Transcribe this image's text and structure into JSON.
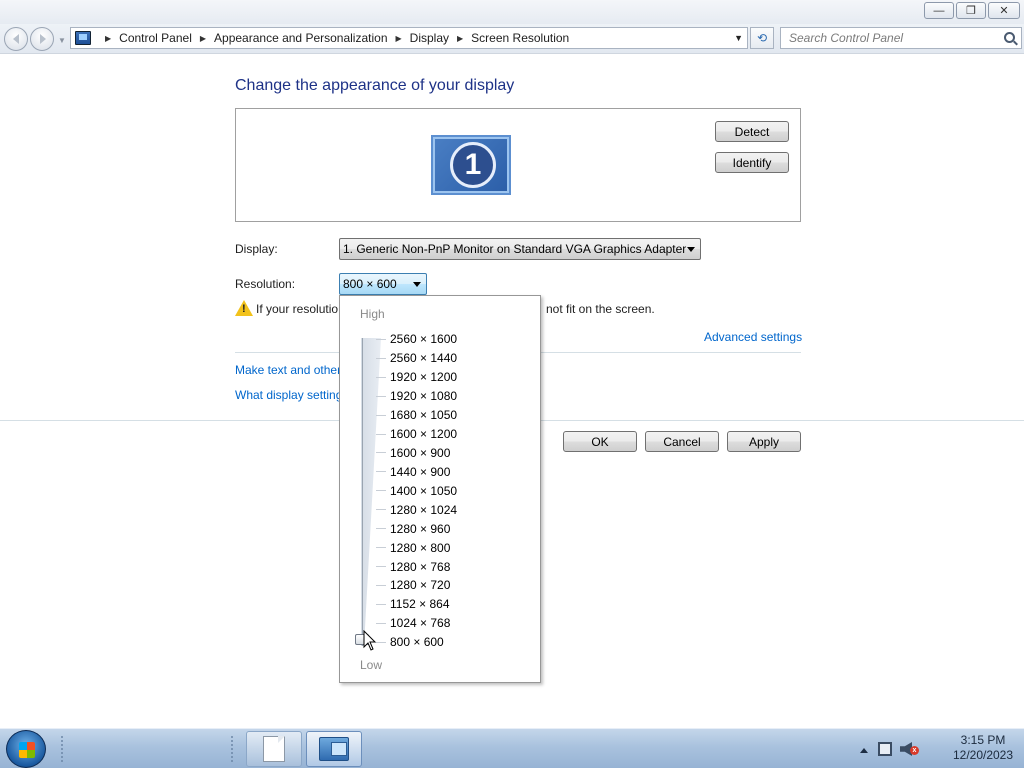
{
  "window": {
    "minimize_glyph": "—",
    "maximize_glyph": "❐",
    "close_glyph": "✕"
  },
  "navbar": {
    "breadcrumbs": [
      "Control Panel",
      "Appearance and Personalization",
      "Display",
      "Screen Resolution"
    ],
    "refresh_glyph": "⟲",
    "search_placeholder": "Search Control Panel"
  },
  "main": {
    "title": "Change the appearance of your display",
    "monitor_number": "1",
    "detect_label": "Detect",
    "identify_label": "Identify",
    "display_label": "Display:",
    "display_value": "1. Generic Non-PnP Monitor on Standard VGA Graphics Adapter",
    "resolution_label": "Resolution:",
    "resolution_value": "800 × 600",
    "warning_prefix": "If your resolutio",
    "warning_suffix": "not fit on the screen.",
    "advanced_settings": "Advanced settings",
    "link_text_size": "Make text and other",
    "link_settings": "What display setting",
    "ok_label": "OK",
    "cancel_label": "Cancel",
    "apply_label": "Apply"
  },
  "resolution_dropdown": {
    "high_label": "High",
    "low_label": "Low",
    "options": [
      "2560 × 1600",
      "2560 × 1440",
      "1920 × 1200",
      "1920 × 1080",
      "1680 × 1050",
      "1600 × 1200",
      "1600 × 900",
      "1440 × 900",
      "1400 × 1050",
      "1280 × 1024",
      "1280 × 960",
      "1280 × 800",
      "1280 × 768",
      "1280 × 720",
      "1152 × 864",
      "1024 × 768",
      "800 × 600"
    ],
    "selected": "800 × 600"
  },
  "taskbar": {
    "clock_time": "3:15 PM",
    "clock_date": "12/20/2023",
    "mute_glyph": "x",
    "icons": [
      "start-orb",
      "notepad-icon",
      "control-panel-icon",
      "network-icon",
      "volume-muted-icon"
    ]
  }
}
